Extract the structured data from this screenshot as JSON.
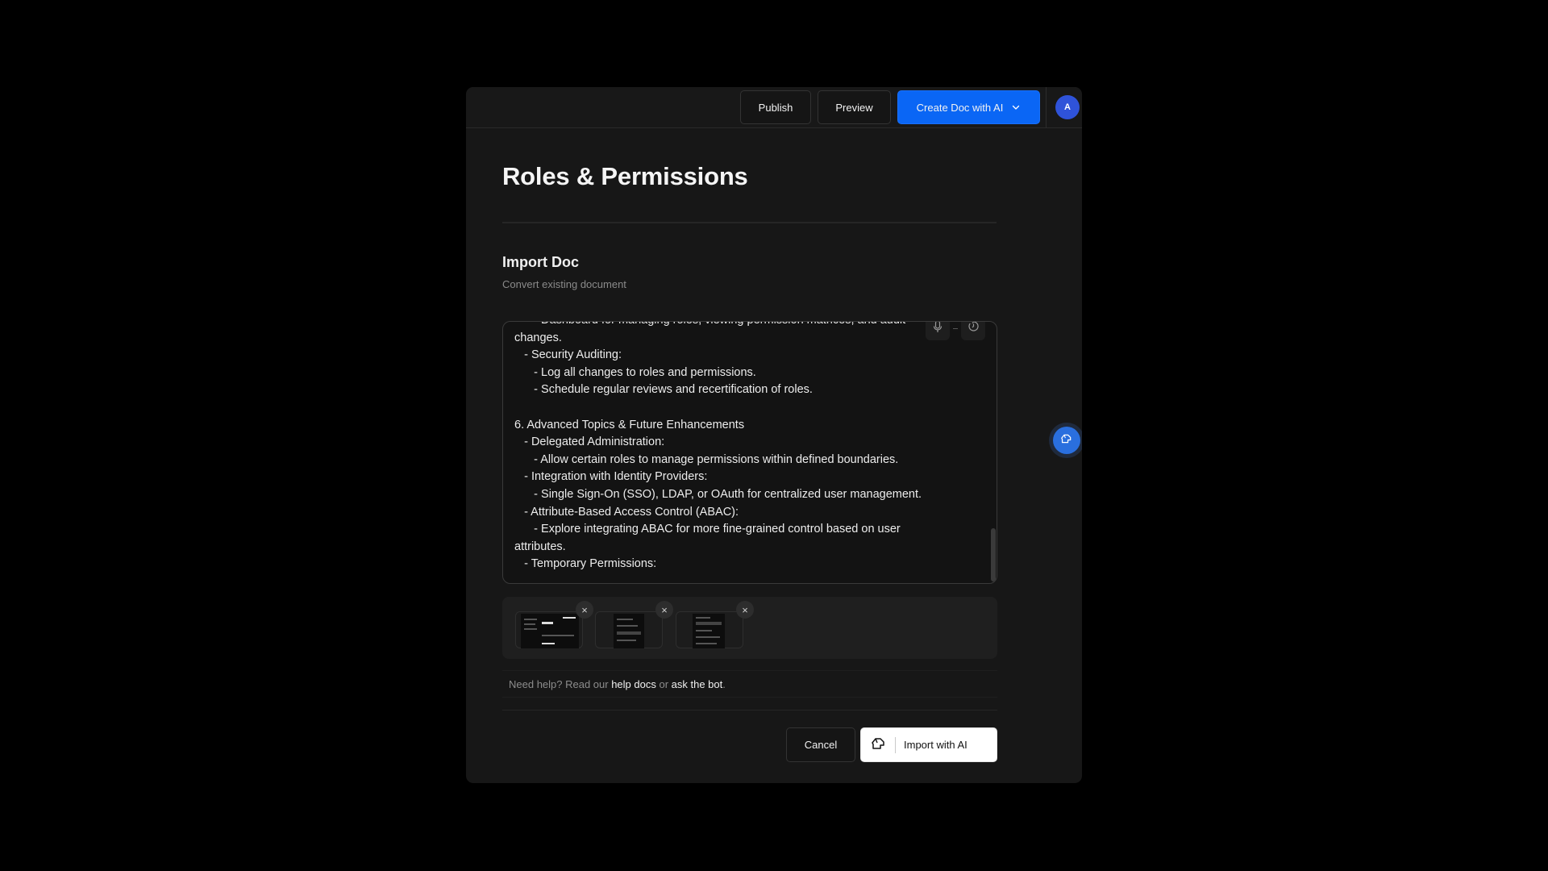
{
  "header": {
    "publish_label": "Publish",
    "preview_label": "Preview",
    "create_doc_label": "Create Doc with AI",
    "avatar_initial": "A"
  },
  "page": {
    "title": "Roles & Permissions"
  },
  "import_section": {
    "title": "Import Doc",
    "subtitle": "Convert existing document",
    "editor_text": "      - Dashboard for managing roles, viewing permission matrices, and audit\nchanges.\n   - Security Auditing:\n      - Log all changes to roles and permissions.\n      - Schedule regular reviews and recertification of roles.\n\n6. Advanced Topics & Future Enhancements\n   - Delegated Administration:\n      - Allow certain roles to manage permissions within defined boundaries.\n   - Integration with Identity Providers:\n      - Single Sign-On (SSO), LDAP, or OAuth for centralized user management.\n   - Attribute-Based Access Control (ABAC):\n      - Explore integrating ABAC for more fine-grained control based on user\nattributes.\n   - Temporary Permissions:",
    "tools": [
      {
        "icon": "microphone-icon"
      },
      {
        "icon": "history-icon"
      }
    ],
    "attachments": [
      {
        "name": "screenshot-1",
        "remove_icon": "close-icon"
      },
      {
        "name": "screenshot-2",
        "remove_icon": "close-icon"
      },
      {
        "name": "screenshot-3",
        "remove_icon": "close-icon"
      }
    ],
    "remove_glyph": "×"
  },
  "help": {
    "prefix": "Need help? Read our ",
    "docs_link": "help docs",
    "middle": " or ",
    "bot_link": "ask the bot",
    "suffix": "."
  },
  "footer": {
    "cancel_label": "Cancel",
    "import_label": "Import with AI"
  },
  "colors": {
    "accent": "#0a66f5",
    "avatar": "#2f53d9",
    "fab": "#2a6fde",
    "panel_bg": "#171717"
  }
}
